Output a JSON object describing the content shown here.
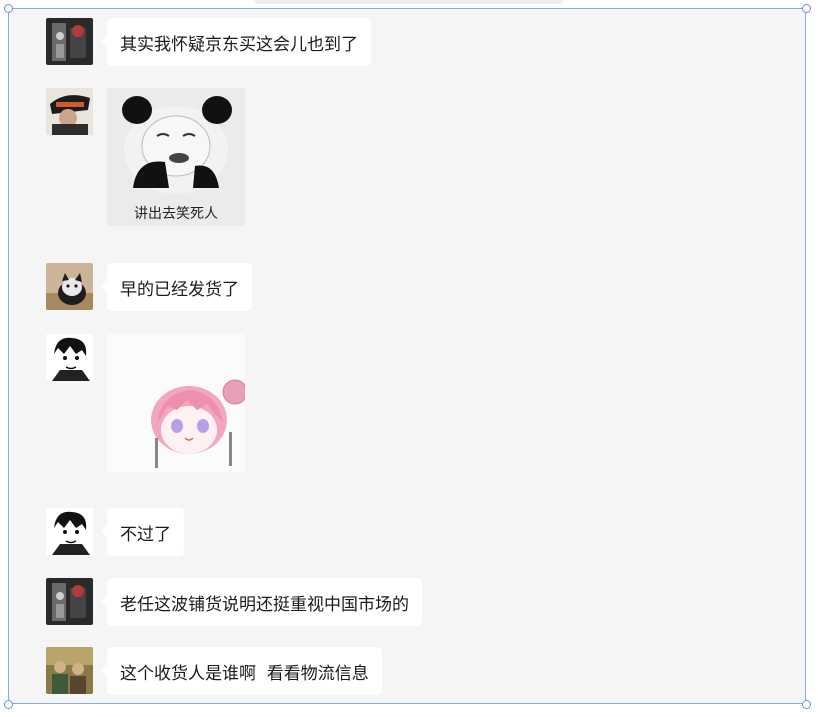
{
  "messages": [
    {
      "type": "text",
      "text": "其实我怀疑京东买这会儿也到了",
      "avatar": "avatar-dark-portrait"
    },
    {
      "type": "sticker",
      "caption": "讲出去笑死人",
      "sticker": "panda-meme-sticker",
      "avatar": "avatar-helmet-figure"
    },
    {
      "type": "text",
      "text": "早的已经发货了",
      "avatar": "avatar-cat"
    },
    {
      "type": "sticker",
      "caption": "",
      "sticker": "anime-pink-hair-girl-sticker",
      "avatar": "avatar-manga-boy"
    },
    {
      "type": "text",
      "text": "不过了",
      "avatar": "avatar-manga-boy"
    },
    {
      "type": "text",
      "text": "老任这波铺货说明还挺重视中国市场的",
      "avatar": "avatar-dark-portrait"
    },
    {
      "type": "text",
      "text": "这个收货人是谁啊  看看物流信息",
      "avatar": "avatar-group-photo"
    }
  ],
  "colors": {
    "chat_background": "#f5f5f5",
    "bubble": "#ffffff",
    "text": "#1a1a1a",
    "selection_border": "#8aa8f0"
  }
}
